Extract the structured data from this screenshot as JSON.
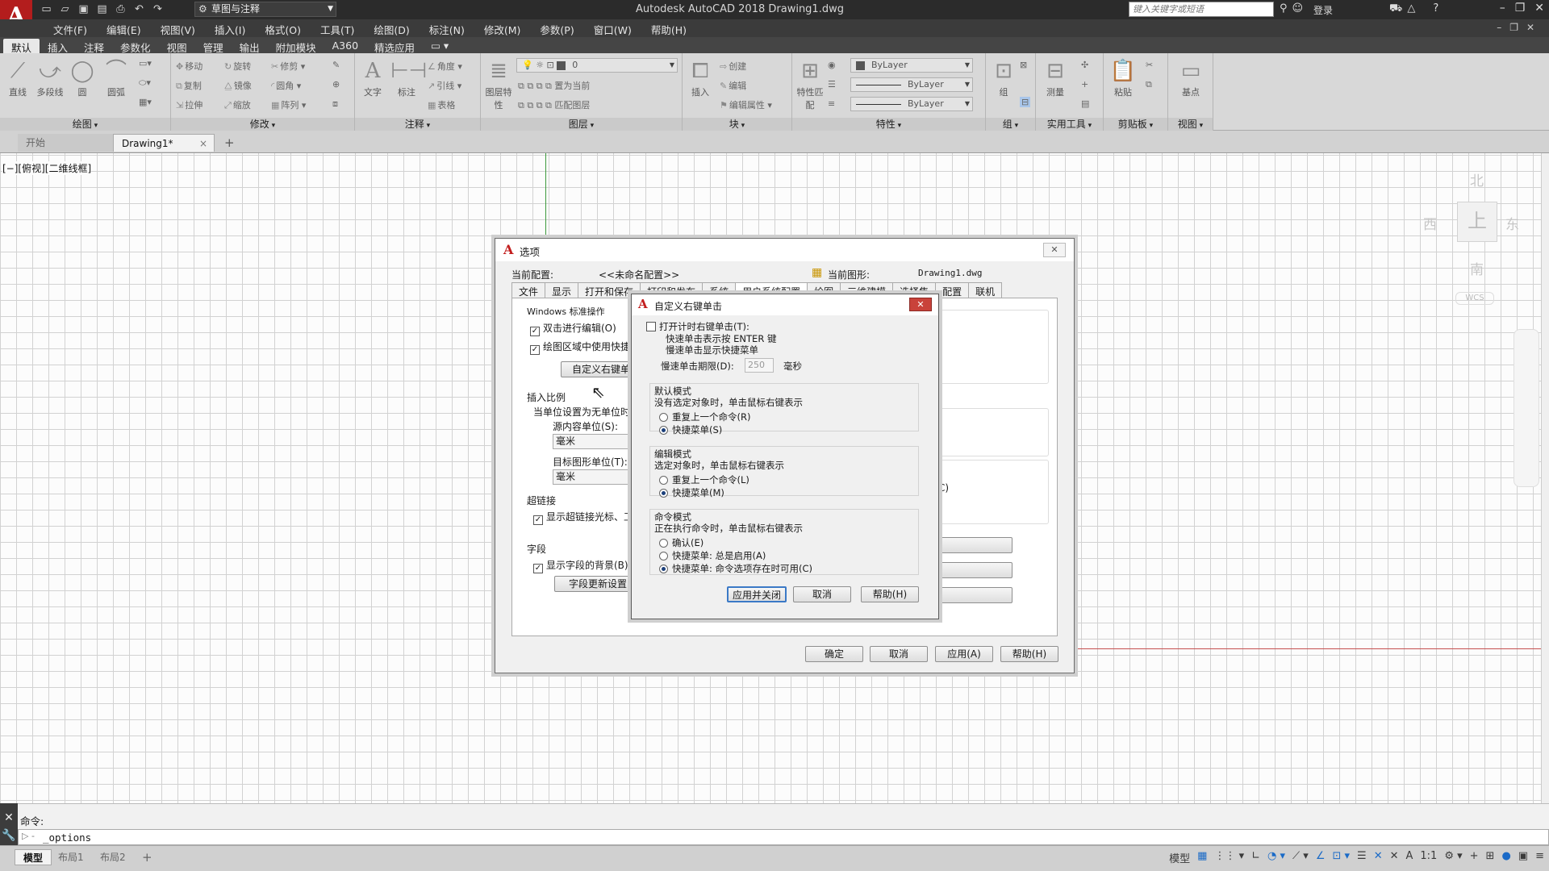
{
  "titlebar": {
    "logo": "A",
    "workspace": "草图与注释",
    "title": "Autodesk AutoCAD 2018    Drawing1.dwg",
    "search_placeholder": "键入关键字或短语",
    "login": "登录",
    "help": "?"
  },
  "menu": [
    "文件(F)",
    "编辑(E)",
    "视图(V)",
    "插入(I)",
    "格式(O)",
    "工具(T)",
    "绘图(D)",
    "标注(N)",
    "修改(M)",
    "参数(P)",
    "窗口(W)",
    "帮助(H)"
  ],
  "ribbon_tabs": [
    "默认",
    "插入",
    "注释",
    "参数化",
    "视图",
    "管理",
    "输出",
    "附加模块",
    "A360",
    "精选应用"
  ],
  "ribbon": {
    "draw": {
      "title": "绘图",
      "line": "直线",
      "polyline": "多段线",
      "circle": "圆",
      "arc": "圆弧"
    },
    "modify": {
      "title": "修改",
      "move": "移动",
      "rotate": "旋转",
      "trim": "修剪",
      "copy": "复制",
      "mirror": "镜像",
      "fillet": "圆角",
      "stretch": "拉伸",
      "scale": "缩放",
      "array": "阵列"
    },
    "annotation": {
      "title": "注释",
      "text": "文字",
      "dimension": "标注",
      "angle": "角度",
      "leader": "引线",
      "table": "表格"
    },
    "layers": {
      "title": "图层",
      "layer_props": "图层特性",
      "current_layer": "0",
      "set_current": "置为当前",
      "match_layer": "匹配图层"
    },
    "block": {
      "title": "块",
      "insert": "插入",
      "create": "创建",
      "edit": "编辑",
      "edit_attr": "编辑属性"
    },
    "properties": {
      "title": "特性",
      "match": "特性匹配",
      "color": "ByLayer",
      "linetype": "ByLayer",
      "lineweight": "ByLayer"
    },
    "groups": {
      "title": "组",
      "group": "组"
    },
    "utilities": {
      "title": "实用工具",
      "measure": "测量"
    },
    "clipboard": {
      "title": "剪贴板",
      "paste": "粘贴"
    },
    "view": {
      "title": "视图",
      "base": "基点"
    }
  },
  "file_tabs": {
    "start": "开始",
    "drawing": "Drawing1*",
    "close": "×",
    "add": "+"
  },
  "viewport": {
    "label": "[−][俯视][二维线框]"
  },
  "viewcube": {
    "north": "北",
    "south": "南",
    "east": "东",
    "west": "西",
    "face": "上",
    "wcs": "WCS"
  },
  "options_dialog": {
    "title": "选项",
    "current_profile_label": "当前配置:",
    "current_profile": "<<未命名配置>>",
    "current_drawing_label": "当前图形:",
    "current_drawing": "Drawing1.dwg",
    "tabs": [
      "文件",
      "显示",
      "打开和保存",
      "打印和发布",
      "系统",
      "用户系统配置",
      "绘图",
      "三维建模",
      "选择集",
      "配置",
      "联机"
    ],
    "windows_group": "Windows 标准操作",
    "dbl_click_edit": "双击进行编辑(O)",
    "shortcut_menu": "绘图区域中使用快捷",
    "right_click_btn": "自定义右键单",
    "insert_scale": "插入比例",
    "unitless_label": "当单位设置为无单位时",
    "source_units_label": "源内容单位(S):",
    "source_units": "毫米",
    "target_units_label": "目标图形单位(T):",
    "target_units": "毫米",
    "hyperlink": "超链接",
    "show_hyperlink": "显示超链接光标、工",
    "field": "字段",
    "show_field_bg": "显示字段的背景(B)",
    "field_update_btn": "字段更新设置",
    "partial_c": "C)",
    "ok": "确定",
    "cancel": "取消",
    "apply": "应用(A)",
    "help": "帮助(H)"
  },
  "rightclick_dialog": {
    "title": "自定义右键单击",
    "timed_rightclick": "打开计时右键单击(T):",
    "quick_click": "快速单击表示按 ENTER 键",
    "slow_click": "慢速单击显示快捷菜单",
    "slow_duration_label": "慢速单击期限(D):",
    "slow_duration": "250",
    "ms": "毫秒",
    "default_mode": "默认模式",
    "default_desc": "没有选定对象时，单击鼠标右键表示",
    "default_repeat": "重复上一个命令(R)",
    "default_menu": "快捷菜单(S)",
    "edit_mode": "编辑模式",
    "edit_desc": "选定对象时，单击鼠标右键表示",
    "edit_repeat": "重复上一个命令(L)",
    "edit_menu": "快捷菜单(M)",
    "cmd_mode": "命令模式",
    "cmd_desc": "正在执行命令时，单击鼠标右键表示",
    "cmd_enter": "确认(E)",
    "cmd_menu_always": "快捷菜单: 总是启用(A)",
    "cmd_menu_options": "快捷菜单: 命令选项存在时可用(C)",
    "apply_close": "应用并关闭",
    "cancel": "取消",
    "help": "帮助(H)"
  },
  "command": {
    "history": "命令:",
    "prompt": "▷ -",
    "input": "_options"
  },
  "status": {
    "model": "模型",
    "layout1": "布局1",
    "layout2": "布局2",
    "add": "+",
    "mode": "模型",
    "scale": "1:1"
  }
}
